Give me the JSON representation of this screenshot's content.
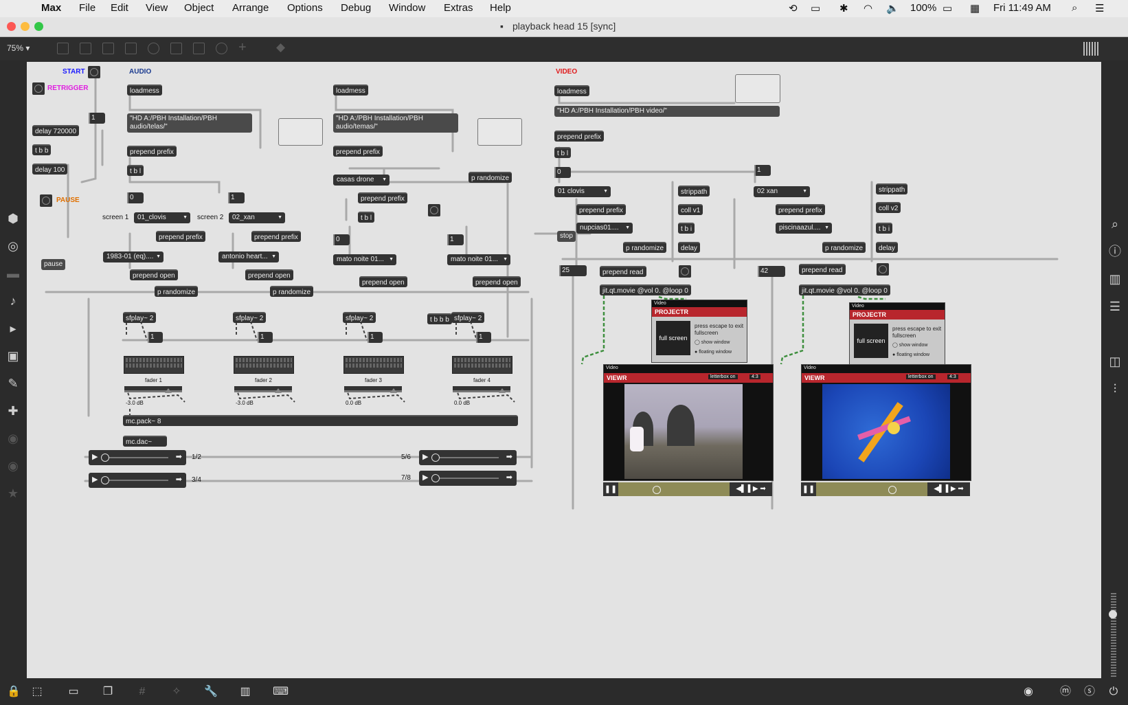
{
  "menubar": {
    "apple": "",
    "app": "Max",
    "items": [
      "File",
      "Edit",
      "View",
      "Object",
      "Arrange",
      "Options",
      "Debug",
      "Window",
      "Extras",
      "Help"
    ],
    "battery": "100%",
    "clock": "Fri 11:49 AM"
  },
  "window": {
    "title": "playback head 15 [sync]"
  },
  "toolbar": {
    "zoom": "75%"
  },
  "patch": {
    "labels": {
      "start": "START",
      "audio": "AUDIO",
      "video": "VIDEO",
      "retrigger": "RETRIGGER",
      "pause": "PAUSE"
    },
    "left": {
      "one": "1",
      "delay720000": "delay 720000",
      "tbb": "t b b",
      "delay100": "delay 100",
      "pause_msg": "pause"
    },
    "audio_col1": {
      "loadmess": "loadmess",
      "path": "\"HD A:/PBH Installation/PBH audio/telas/\"",
      "prefix": "prepend prefix",
      "tbl": "t b l",
      "zero": "0",
      "one": "1",
      "screen1": "screen 1",
      "menu1": "01_clovis",
      "screen2": "screen 2",
      "menu2": "02_xan",
      "prefix2a": "prepend prefix",
      "prefix2b": "prepend prefix",
      "file1": "1983-01 (eq)....",
      "file2": "antonio heart...",
      "open1": "prepend open",
      "open2": "prepend open",
      "rand1": "p randomize",
      "rand2": "p randomize"
    },
    "audio_col2": {
      "loadmess": "loadmess",
      "path": "\"HD A:/PBH Installation/PBH audio/temas/\"",
      "prefix": "prepend prefix",
      "menu": "casas drone",
      "rand": "p randomize",
      "prefix2": "prepend prefix",
      "tbl": "t b l",
      "zero": "0",
      "one": "1",
      "file3": "mato noite 01...",
      "file4": "mato noite 01...",
      "open3": "prepend open",
      "open4": "prepend open",
      "tbbb": "t b b b",
      "stop": "stop"
    },
    "players": [
      {
        "sf": "sfplay~ 2",
        "one": "1",
        "fader": "fader 1",
        "db": "-3.0 dB",
        "level": 0.8
      },
      {
        "sf": "sfplay~ 2",
        "one": "1",
        "fader": "fader 2",
        "db": "-3.0 dB",
        "level": 0.8
      },
      {
        "sf": "sfplay~ 2",
        "one": "1",
        "fader": "fader 3",
        "db": "0.0 dB",
        "level": 0.9
      },
      {
        "sf": "sfplay~ 2",
        "one": "1",
        "fader": "fader 4",
        "db": "0.0 dB",
        "level": 0.9
      }
    ],
    "pack": "mc.pack~ 8",
    "dac": "mc.dac~",
    "transports": [
      "1/2",
      "3/4",
      "5/6",
      "7/8"
    ],
    "video": {
      "loadmess": "loadmess",
      "path": "\"HD A:/PBH Installation/PBH video/\"",
      "prefix": "prepend prefix",
      "tbl": "t b l",
      "zero": "0",
      "one": "1",
      "menuA": "01 clovis",
      "menuB": "02 xan",
      "prefixA": "prepend prefix",
      "prefixB": "prepend prefix",
      "fileA": "nupcias01....",
      "fileB": "piscinaazul....",
      "randA": "p randomize",
      "randB": "p randomize",
      "stripA": "strippath",
      "stripB": "strippath",
      "collA": "coll v1",
      "collB": "coll v2",
      "tbiA": "t b i",
      "tbiB": "t b i",
      "delayA": "delay",
      "delayB": "delay",
      "numA": "25",
      "numB": "42",
      "readA": "prepend read",
      "readB": "prepend read",
      "movieA": "jit.qt.movie @vol 0. @loop 0",
      "movieB": "jit.qt.movie @vol 0. @loop 0",
      "projector": {
        "hdr": "Video",
        "title": "PROJECTR",
        "btn": "full screen",
        "text": "press escape to exit fullscreen",
        "opt1": "show window",
        "opt2": "floating window"
      },
      "viewer": {
        "hdr": "Video",
        "title": "VIEWR",
        "letterbox": "letterbox on",
        "ratio": "4:3"
      }
    }
  },
  "colors": {
    "start": "#1a1aff",
    "audio": "#1a3a8f",
    "video": "#e0191b",
    "retrigger": "#e020e0",
    "pause": "#e07000",
    "canvas": "#e3e3e3"
  }
}
